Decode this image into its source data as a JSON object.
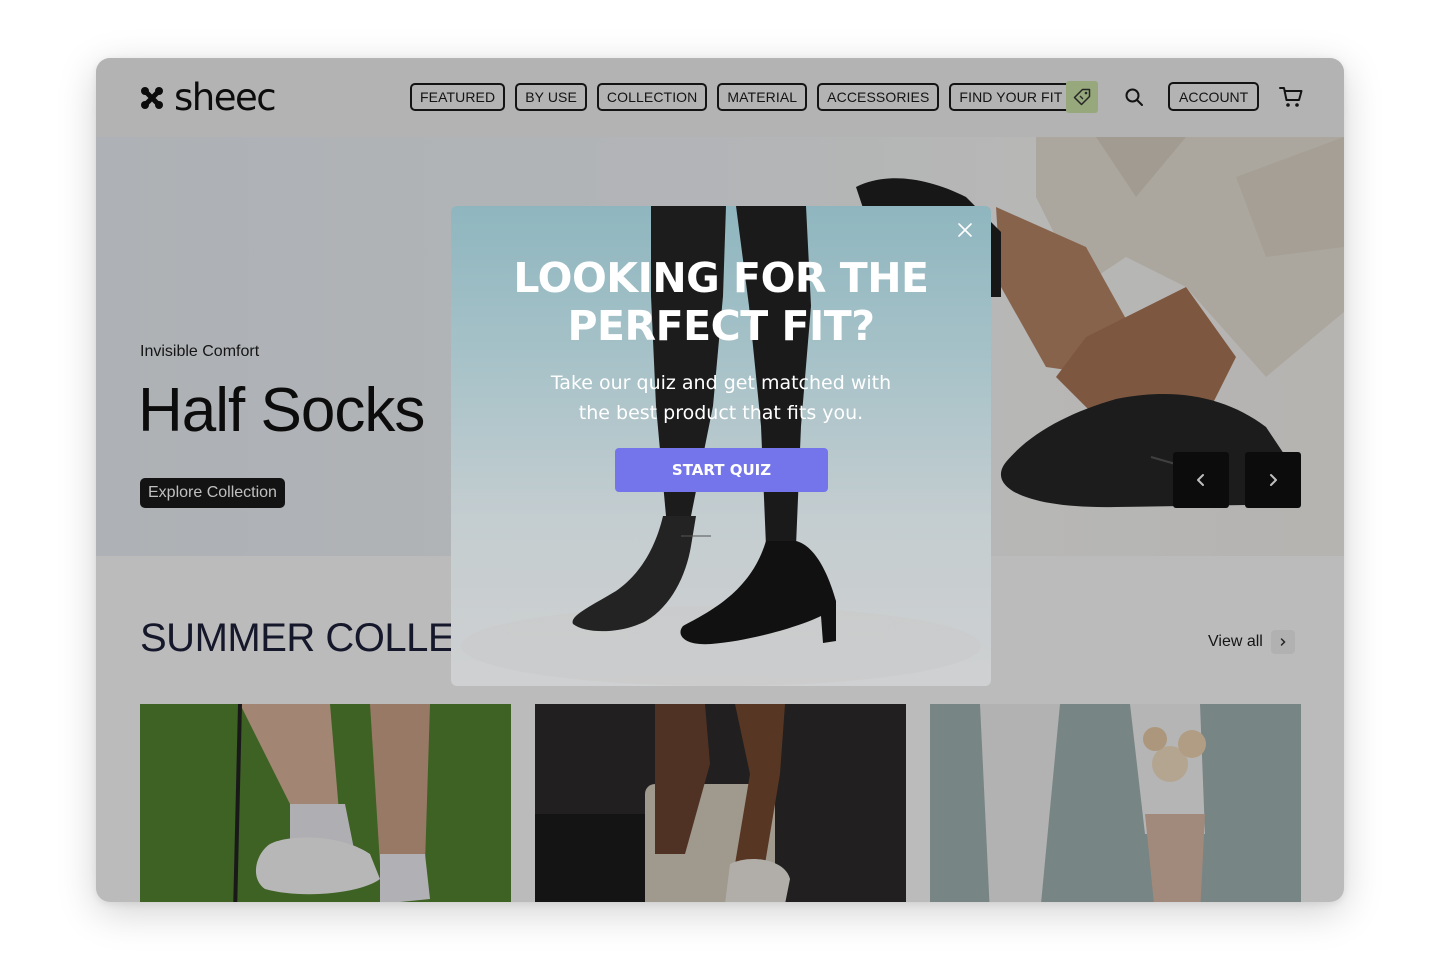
{
  "brand": {
    "name": "sheec"
  },
  "nav": {
    "items": [
      {
        "label": "FEATURED"
      },
      {
        "label": "BY USE"
      },
      {
        "label": "COLLECTION"
      },
      {
        "label": "MATERIAL"
      },
      {
        "label": "ACCESSORIES"
      },
      {
        "label": "FIND YOUR FIT"
      }
    ],
    "account_label": "ACCOUNT",
    "deal_icon": "tag-icon",
    "search_icon": "search-icon",
    "cart_icon": "cart-icon"
  },
  "hero": {
    "subtitle": "Invisible Comfort",
    "title": "Half Socks",
    "cta_label": "Explore Collection",
    "prev_icon": "chevron-left-icon",
    "next_icon": "chevron-right-icon"
  },
  "collection": {
    "title": "SUMMER COLLECTION",
    "view_all_label": "View all"
  },
  "modal": {
    "title_line1": "LOOKING FOR THE",
    "title_line2": "PERFECT FIT?",
    "text_line1": "Take our quiz and get matched with",
    "text_line2": "the best product that fits you.",
    "cta_label": "START QUIZ",
    "close_icon": "close-icon"
  },
  "colors": {
    "accent": "#7474eb",
    "deal_badge": "#c8e0a6",
    "dark": "#1a1a1a"
  }
}
